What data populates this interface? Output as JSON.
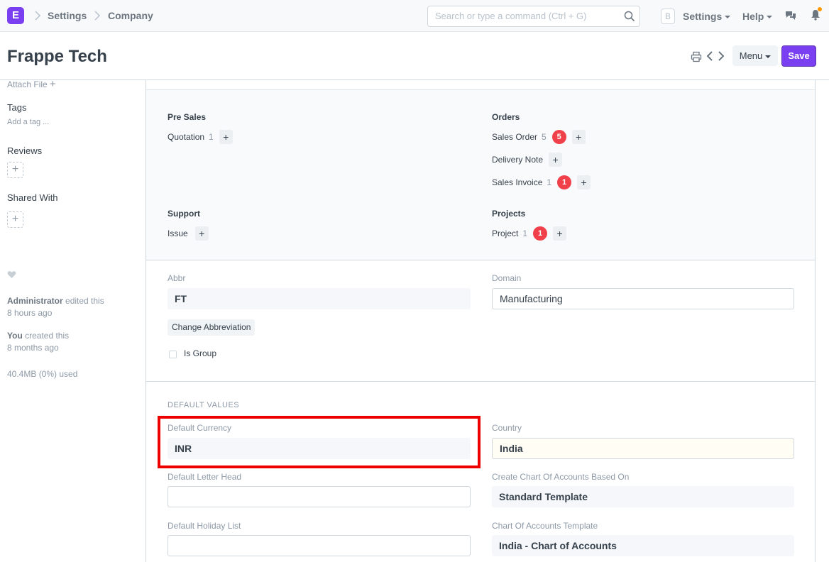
{
  "navbar": {
    "logo_letter": "E",
    "breadcrumbs": [
      "Settings",
      "Company"
    ],
    "search_placeholder": "Search or type a command (Ctrl + G)",
    "avatar_letter": "B",
    "settings_label": "Settings",
    "help_label": "Help"
  },
  "page": {
    "title": "Frappe Tech",
    "menu_label": "Menu",
    "save_label": "Save"
  },
  "sidebar": {
    "attach_label": "Attach File",
    "tags_heading": "Tags",
    "add_tag": "Add a tag ...",
    "reviews_heading": "Reviews",
    "shared_heading": "Shared With",
    "activity": [
      {
        "user": "Administrator",
        "action": " edited this",
        "time": "8 hours ago"
      },
      {
        "user": "You",
        "action": " created this",
        "time": "8 months ago"
      }
    ],
    "storage": "40.4MB (0%) used"
  },
  "dashboard": {
    "groups": [
      {
        "label": "Pre Sales",
        "items": [
          {
            "label": "Quotation",
            "count": "1",
            "badge": ""
          }
        ]
      },
      {
        "label": "Orders",
        "items": [
          {
            "label": "Sales Order",
            "count": "5",
            "badge": "5"
          },
          {
            "label": "Delivery Note",
            "count": "",
            "badge": ""
          },
          {
            "label": "Sales Invoice",
            "count": "1",
            "badge": "1"
          }
        ]
      },
      {
        "label": "Support",
        "items": [
          {
            "label": "Issue",
            "count": "",
            "badge": ""
          }
        ]
      },
      {
        "label": "Projects",
        "items": [
          {
            "label": "Project",
            "count": "1",
            "badge": "1"
          }
        ]
      }
    ]
  },
  "form": {
    "abbr_label": "Abbr",
    "abbr_value": "FT",
    "domain_label": "Domain",
    "domain_value": "Manufacturing",
    "change_abbr_label": "Change Abbreviation",
    "is_group_label": "Is Group",
    "default_values_heading": "DEFAULT VALUES",
    "default_currency_label": "Default Currency",
    "default_currency_value": "INR",
    "country_label": "Country",
    "country_value": "India",
    "letter_head_label": "Default Letter Head",
    "letter_head_value": "",
    "coa_based_label": "Create Chart Of Accounts Based On",
    "coa_based_value": "Standard Template",
    "holiday_label": "Default Holiday List",
    "holiday_value": "",
    "coa_template_label": "Chart Of Accounts Template",
    "coa_template_value": "India - Chart of Accounts"
  },
  "colors": {
    "brand": "#7b3ff2",
    "badge": "#f0414a",
    "highlight": "#ee0000",
    "notification": "#ff9800"
  }
}
